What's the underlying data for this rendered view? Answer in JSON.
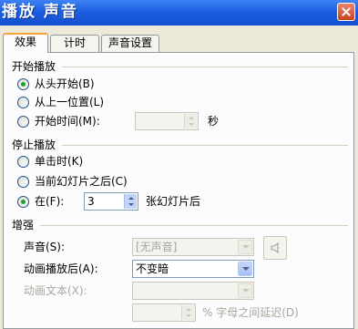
{
  "window": {
    "title": "播放 声音"
  },
  "tabs": [
    {
      "label": "效果"
    },
    {
      "label": "计时"
    },
    {
      "label": "声音设置"
    }
  ],
  "start_group": {
    "title": "开始播放",
    "options": [
      {
        "label": "从头开始(B)",
        "checked": true
      },
      {
        "label": "从上一位置(L)",
        "checked": false
      },
      {
        "label": "开始时间(M):",
        "checked": false
      }
    ],
    "start_time_value": "",
    "seconds_unit": "秒"
  },
  "stop_group": {
    "title": "停止播放",
    "options": [
      {
        "label": "单击时(K)",
        "checked": false
      },
      {
        "label": "当前幻灯片之后(C)",
        "checked": false
      },
      {
        "label": "在(F):",
        "checked": true
      }
    ],
    "slides_value": "3",
    "slides_suffix": "张幻灯片后"
  },
  "enhance_group": {
    "title": "增强",
    "sound_label": "声音(S):",
    "sound_value": "[无声音]",
    "after_anim_label": "动画播放后(A):",
    "after_anim_value": "不变暗",
    "anim_text_label": "动画文本(X):",
    "anim_text_value": "",
    "delay_value": "",
    "delay_suffix": "% 字母之间延迟(D)"
  },
  "icons": {
    "speaker": "speaker-icon",
    "close": "close-icon"
  },
  "colors": {
    "titlebar": "#1d5fe0",
    "tab_accent": "#f3a53b",
    "radio_dot": "#21a121"
  }
}
